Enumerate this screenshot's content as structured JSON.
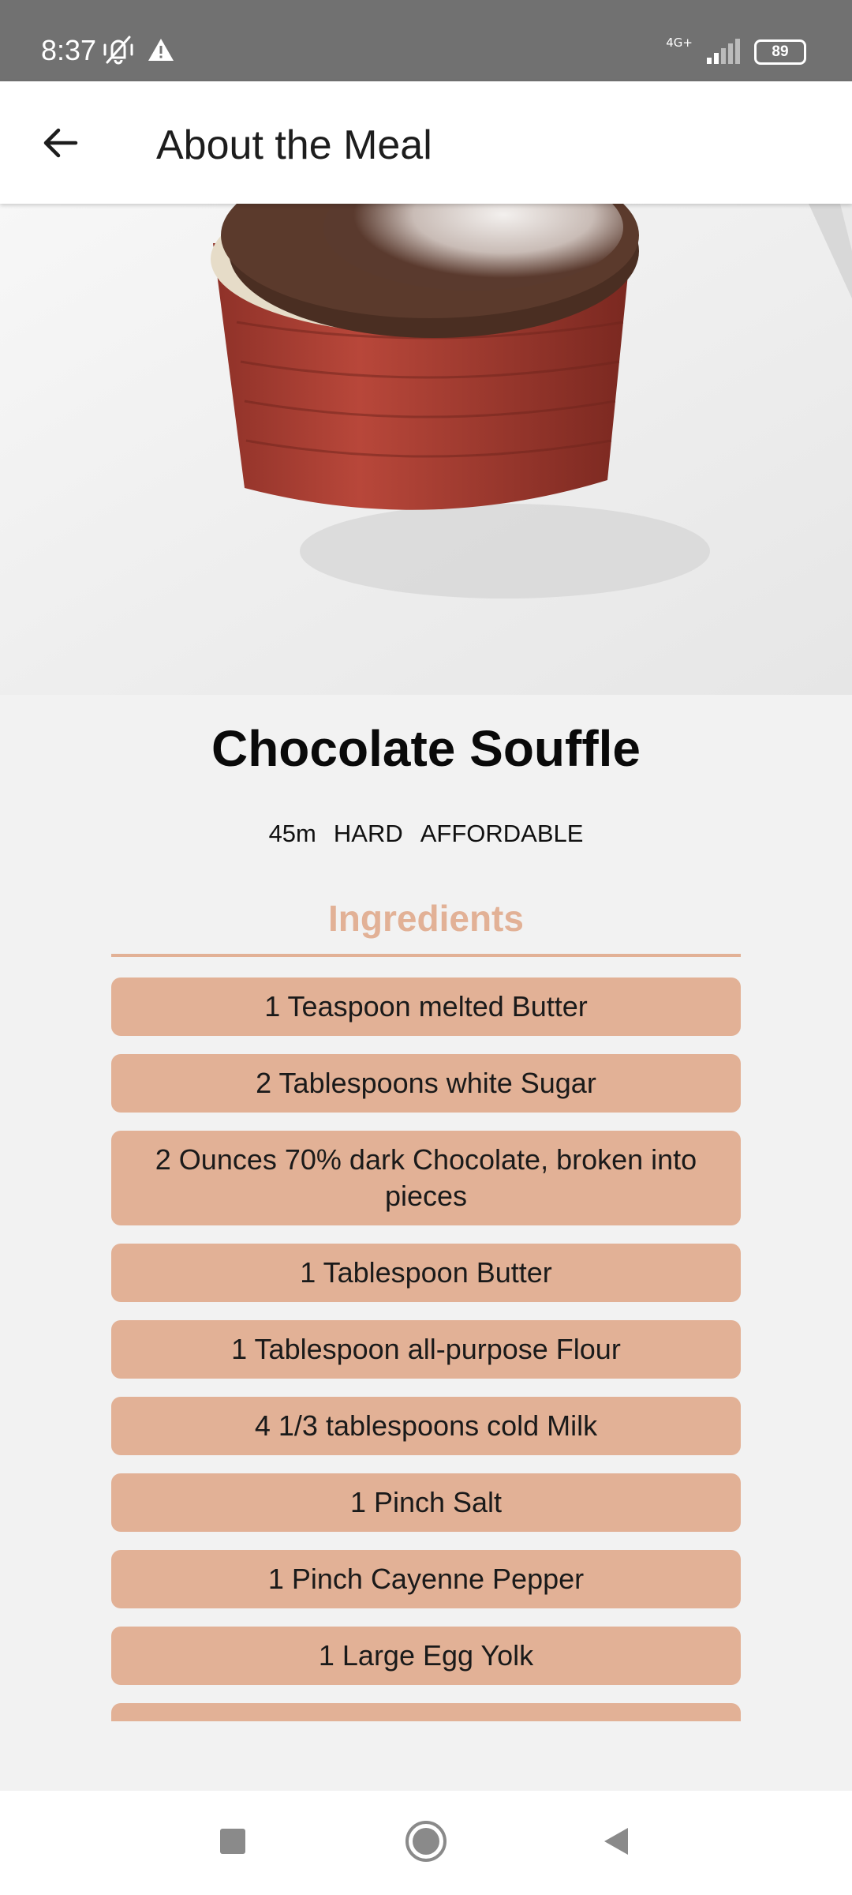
{
  "status_bar": {
    "time": "8:37",
    "network": "4G+",
    "battery": "89"
  },
  "app_bar": {
    "title": "About the Meal"
  },
  "meal": {
    "title": "Chocolate Souffle",
    "duration": "45m",
    "complexity": "HARD",
    "affordability": "AFFORDABLE"
  },
  "ingredients": {
    "heading": "Ingredients",
    "items": [
      "1 Teaspoon melted Butter",
      "2 Tablespoons white Sugar",
      "2 Ounces 70% dark Chocolate, broken into pieces",
      "1 Tablespoon Butter",
      "1 Tablespoon all-purpose Flour",
      "4 1/3 tablespoons cold Milk",
      "1 Pinch Salt",
      "1 Pinch Cayenne Pepper",
      "1 Large Egg Yolk",
      ""
    ]
  },
  "colors": {
    "accent": "#e2b196",
    "status_bar": "#717171",
    "background": "#f2f2f2"
  }
}
